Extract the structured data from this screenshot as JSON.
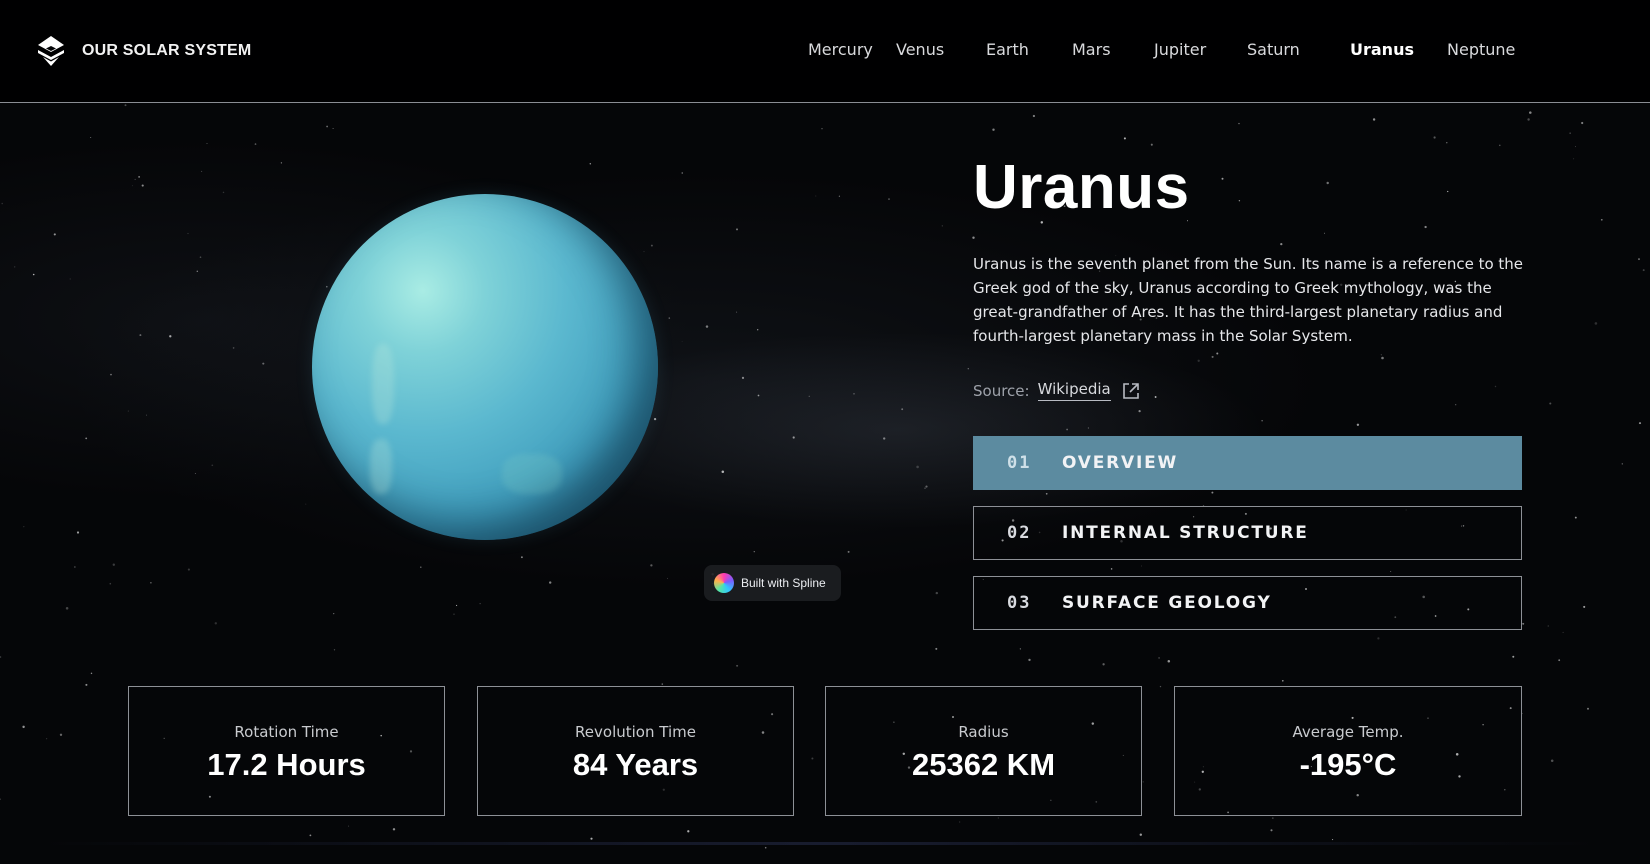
{
  "brand": {
    "title": "OUR SOLAR SYSTEM",
    "logo_icon": "layered-diamond-logo-icon"
  },
  "nav": {
    "items": [
      "Mercury",
      "Venus",
      "Earth",
      "Mars",
      "Jupiter",
      "Saturn",
      "Uranus",
      "Neptune"
    ],
    "active": "Uranus"
  },
  "planet": {
    "name": "Uranus",
    "description": "Uranus is the seventh planet from the Sun. Its name is a reference to the Greek god of the sky, Uranus according to Greek mythology, was the great-grandfather of Ares. It has the third-largest planetary radius and fourth-largest planetary mass in the Solar System.",
    "source_label": "Source:",
    "source_link": "Wikipedia",
    "source_icon": "external-link-icon",
    "colors": {
      "surface": "#5bb8cf",
      "highlight": "#a9ece4",
      "accent": "#5c8ba0"
    }
  },
  "badge": {
    "label": "Built with Spline"
  },
  "tabs": [
    {
      "num": "01",
      "label": "OVERVIEW",
      "active": true
    },
    {
      "num": "02",
      "label": "INTERNAL STRUCTURE",
      "active": false
    },
    {
      "num": "03",
      "label": "SURFACE GEOLOGY",
      "active": false
    }
  ],
  "stats": [
    {
      "label": "Rotation Time",
      "value": "17.2 Hours"
    },
    {
      "label": "Revolution Time",
      "value": "84 Years"
    },
    {
      "label": "Radius",
      "value": "25362 KM"
    },
    {
      "label": "Average Temp.",
      "value": "-195°C"
    }
  ]
}
